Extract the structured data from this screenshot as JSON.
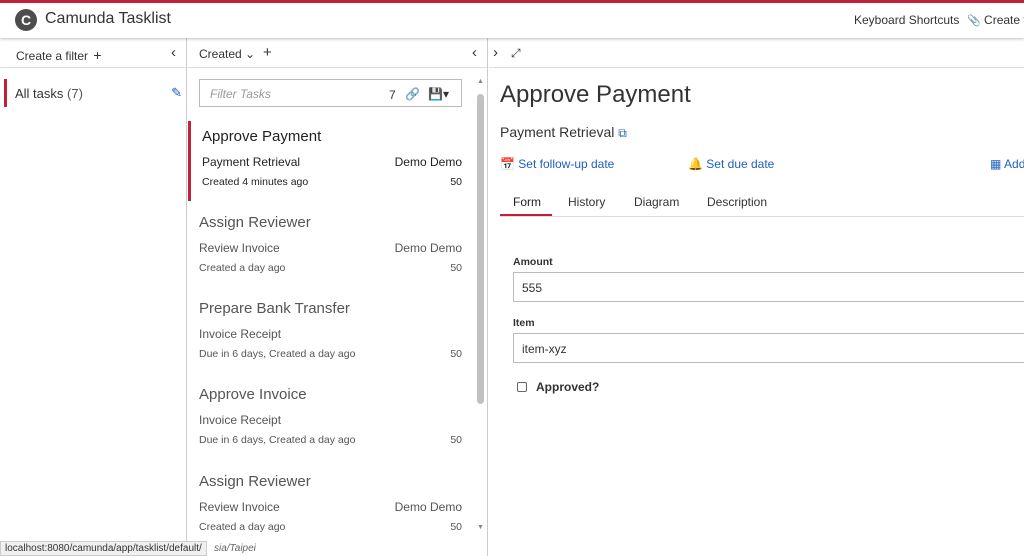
{
  "header": {
    "logo_letter": "C",
    "app_title": "Camunda Tasklist",
    "keyboard_shortcuts": "Keyboard Shortcuts",
    "create_task": "Create t",
    "accent_color": "#c2213a"
  },
  "filters": {
    "create_label": "Create a filter",
    "plus": "+",
    "collapse": "‹",
    "items": [
      {
        "name": "All tasks",
        "count": "(7)"
      }
    ]
  },
  "tasklist": {
    "sort_label": "Created",
    "sort_arrow": "⌄",
    "plus": "+",
    "collapse": "‹",
    "search_placeholder": "Filter Tasks",
    "count": "7",
    "tasks": [
      {
        "name": "Approve Payment",
        "process": "Payment Retrieval",
        "assignee": "Demo Demo",
        "created": "Created 4 minutes ago",
        "priority": "50"
      },
      {
        "name": "Assign Reviewer",
        "process": "Review Invoice",
        "assignee": "Demo Demo",
        "created": "Created a day ago",
        "priority": "50"
      },
      {
        "name": "Prepare Bank Transfer",
        "process": "Invoice Receipt",
        "assignee": "",
        "created": "Due in 6 days, Created a day ago",
        "priority": "50"
      },
      {
        "name": "Approve Invoice",
        "process": "Invoice Receipt",
        "assignee": "",
        "created": "Due in 6 days, Created a day ago",
        "priority": "50"
      },
      {
        "name": "Assign Reviewer",
        "process": "Review Invoice",
        "assignee": "Demo Demo",
        "created": "Created a day ago",
        "priority": "50"
      }
    ]
  },
  "detail": {
    "expand": "›",
    "maximize": "⤢",
    "title": "Approve Payment",
    "process_name": "Payment Retrieval",
    "actions": {
      "follow_up": "Set follow-up date",
      "due": "Set due date",
      "add": "Add"
    },
    "tabs": [
      "Form",
      "History",
      "Diagram",
      "Description"
    ],
    "form": {
      "amount_label": "Amount",
      "amount_value": "555",
      "item_label": "Item",
      "item_value": "item-xyz",
      "approved_label": "Approved?"
    }
  },
  "statusbar": {
    "url": "localhost:8080/camunda/app/tasklist/default/",
    "timezone_fragment": "sia/Taipei"
  }
}
